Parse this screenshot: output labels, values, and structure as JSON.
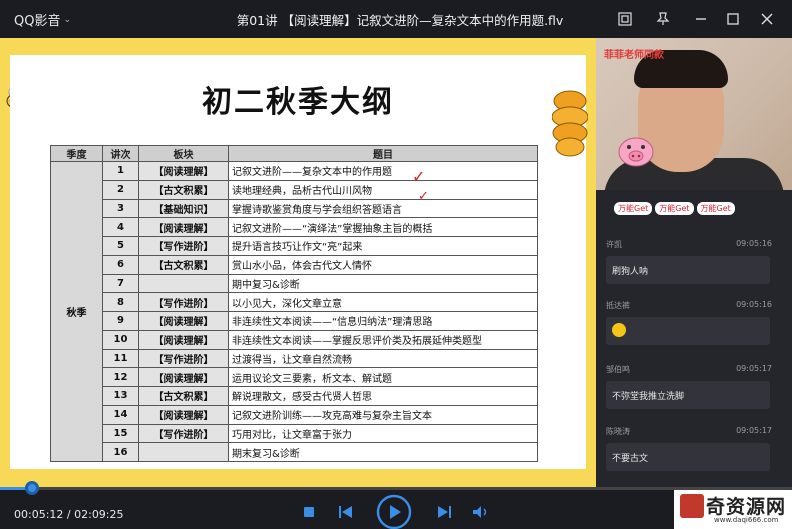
{
  "titlebar": {
    "app_name": "QQ影音",
    "file_title": "第01讲 【阅读理解】记叙文进阶—复杂文本中的作用题.flv"
  },
  "slide": {
    "title": "初二秋季大纲",
    "table": {
      "headers": [
        "季度",
        "讲次",
        "板块",
        "题目"
      ],
      "season": "秋季",
      "rows": [
        {
          "num": "1",
          "module": "【阅读理解】",
          "topic": "记叙文进阶——复杂文本中的作用题"
        },
        {
          "num": "2",
          "module": "【古文积累】",
          "topic": "读地理经典，品析古代山川风物"
        },
        {
          "num": "3",
          "module": "【基础知识】",
          "topic": "掌握诗歌鉴赏角度与学会组织答题语言"
        },
        {
          "num": "4",
          "module": "【阅读理解】",
          "topic": "记叙文进阶——“演绎法”掌握抽象主旨的概括"
        },
        {
          "num": "5",
          "module": "【写作进阶】",
          "topic": "提升语言技巧让作文“亮”起来"
        },
        {
          "num": "6",
          "module": "【古文积累】",
          "topic": "赏山水小品，体会古代文人情怀"
        },
        {
          "num": "7",
          "module": "",
          "topic": "期中复习&诊断"
        },
        {
          "num": "8",
          "module": "【写作进阶】",
          "topic": " 以小见大，深化文章立意"
        },
        {
          "num": "9",
          "module": "【阅读理解】",
          "topic": "非连续性文本阅读——“信息归纳法”理清思路"
        },
        {
          "num": "10",
          "module": "【阅读理解】",
          "topic": "非连续性文本阅读——掌握反思评价类及拓展延伸类题型"
        },
        {
          "num": "11",
          "module": "【写作进阶】",
          "topic": "过渡得当，让文章自然流畅"
        },
        {
          "num": "12",
          "module": "【阅读理解】",
          "topic": "运用议论文三要素，析文本、解试题"
        },
        {
          "num": "13",
          "module": "【古文积累】",
          "topic": "解说理散文，感受古代贤人哲思"
        },
        {
          "num": "14",
          "module": "【阅读理解】",
          "topic": "记叙文进阶训练——攻克高难与复杂主旨文本"
        },
        {
          "num": "15",
          "module": "【写作进阶】",
          "topic": "巧用对比，让文章富于张力"
        },
        {
          "num": "16",
          "module": "",
          "topic": "期末复习&诊断"
        }
      ]
    }
  },
  "camera": {
    "watermark": "菲菲老师同款"
  },
  "chat": {
    "tags": [
      "万能Get",
      "万能Get",
      "万能Get"
    ],
    "messages": [
      {
        "user": "许凯",
        "time": "09:05:16",
        "text": "刷狗人呐"
      },
      {
        "user": "抵达裤",
        "time": "09:05:16",
        "text": ""
      },
      {
        "user": "邹伯鸣",
        "time": "09:05:17",
        "text": "不弥堂我推立洗脚"
      },
      {
        "user": "陈晓涛",
        "time": "09:05:17",
        "text": "不要古文"
      }
    ]
  },
  "player": {
    "time_current": "00:05:12",
    "time_separator": " / ",
    "time_total": "02:09:25",
    "progress": 0.04
  },
  "watermark_logo": {
    "text": "奇资源网",
    "url": "www.daqi666.com"
  },
  "colors": {
    "accent": "#3a8ee6",
    "slide_border": "#f8d957",
    "check_mark": "#e02020"
  }
}
